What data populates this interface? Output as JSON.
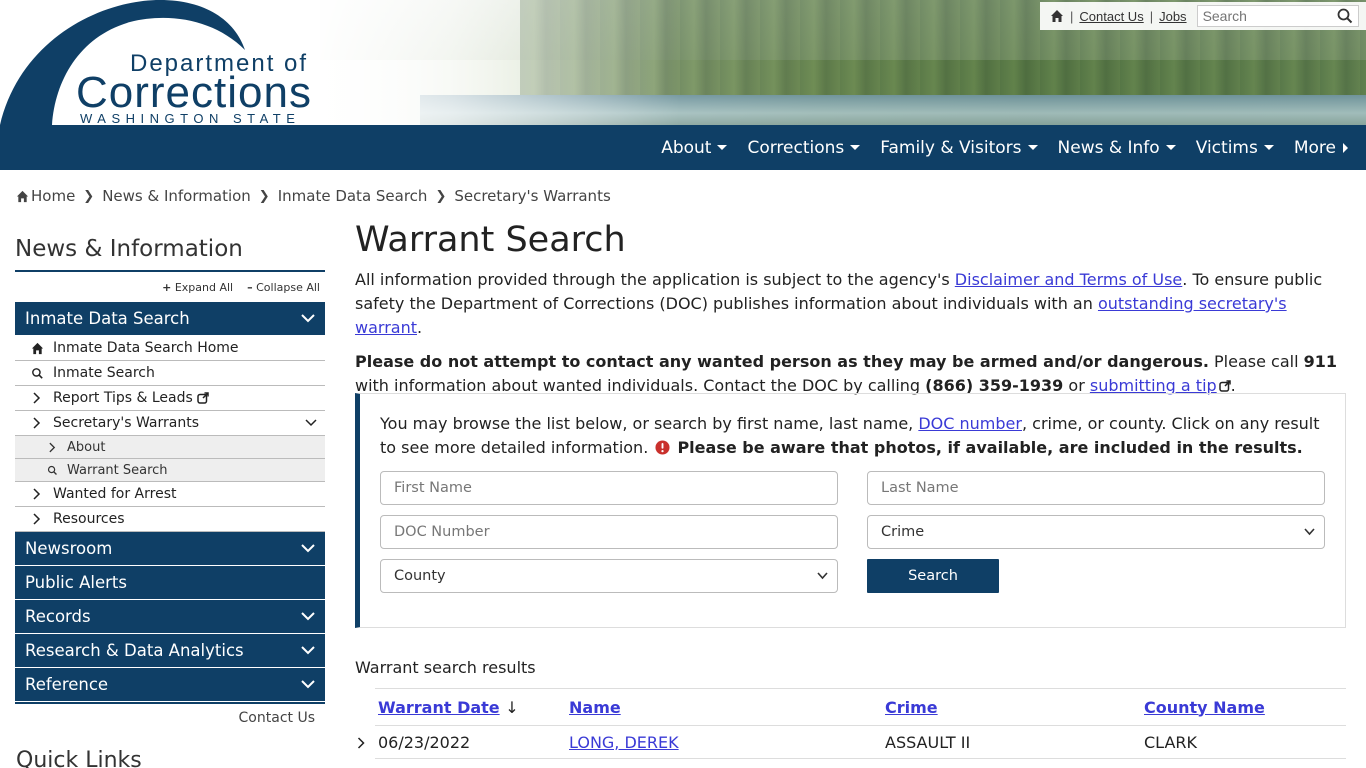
{
  "logo": {
    "line1": "Department of",
    "line2": "Corrections",
    "line3": "WASHINGTON STATE"
  },
  "utility": {
    "contact_label": "Contact Us",
    "separator": "|",
    "jobs_label": "Jobs",
    "search_placeholder": "Search"
  },
  "nav": {
    "items": [
      "About",
      "Corrections",
      "Family & Visitors",
      "News & Info",
      "Victims",
      "More"
    ]
  },
  "breadcrumb": [
    "Home",
    "News & Information",
    "Inmate Data Search",
    "Secretary's Warrants"
  ],
  "sidebar": {
    "title": "News & Information",
    "expand_all": "Expand All",
    "collapse_all": "Collapse All",
    "section_inmate": "Inmate Data Search",
    "items": [
      "Inmate Data Search Home",
      "Inmate Search",
      "Report Tips & Leads",
      "Secretary's Warrants"
    ],
    "sub_items": [
      "About",
      "Warrant Search"
    ],
    "items_after": [
      "Wanted for Arrest",
      "Resources"
    ],
    "sections": [
      "Newsroom",
      "Public Alerts",
      "Records",
      "Research & Data Analytics",
      "Reference"
    ],
    "contact": "Contact Us",
    "quick_links": "Quick Links"
  },
  "main": {
    "title": "Warrant Search",
    "p1_a": "All information provided through the application is subject to the agency's ",
    "p1_link1": "Disclaimer and Terms of Use",
    "p1_b": ". To ensure public safety the Department of Corrections (DOC) publishes information about individuals with an ",
    "p1_link2": "outstanding secretary's warrant",
    "p1_c": ".",
    "p2_bold": "Please do not attempt to contact any wanted person as they may be armed and/or dangerous.",
    "p2_a": " Please call ",
    "p2_911": "911",
    "p2_b": " with information about wanted individuals. Contact the DOC by calling ",
    "p2_phone": "(866) 359-1939",
    "p2_c": " or ",
    "p2_link": "submitting a tip",
    "p2_d": "."
  },
  "panel": {
    "intro_a": "You may browse the list below, or search by first name, last name, ",
    "intro_link": "DOC number",
    "intro_b": ", crime, or county. Click on any result to see more detailed information. ",
    "intro_bold": "Please be aware that photos, if available, are included in the results.",
    "first_name_placeholder": "First Name",
    "last_name_placeholder": "Last Name",
    "doc_placeholder": "DOC Number",
    "crime_select": "Crime",
    "county_select": "County",
    "search_button": "Search"
  },
  "results": {
    "label": "Warrant search results",
    "columns": [
      "Warrant Date",
      "Name",
      "Crime",
      "County Name"
    ],
    "sort_indicator": "↓",
    "rows": [
      {
        "date": "06/23/2022",
        "name": "LONG, DEREK",
        "crime": "ASSAULT II",
        "county": "CLARK"
      }
    ]
  },
  "colors": {
    "brand": "#0f3f66",
    "link": "#3a3ad6",
    "warning": "#c9302c"
  }
}
